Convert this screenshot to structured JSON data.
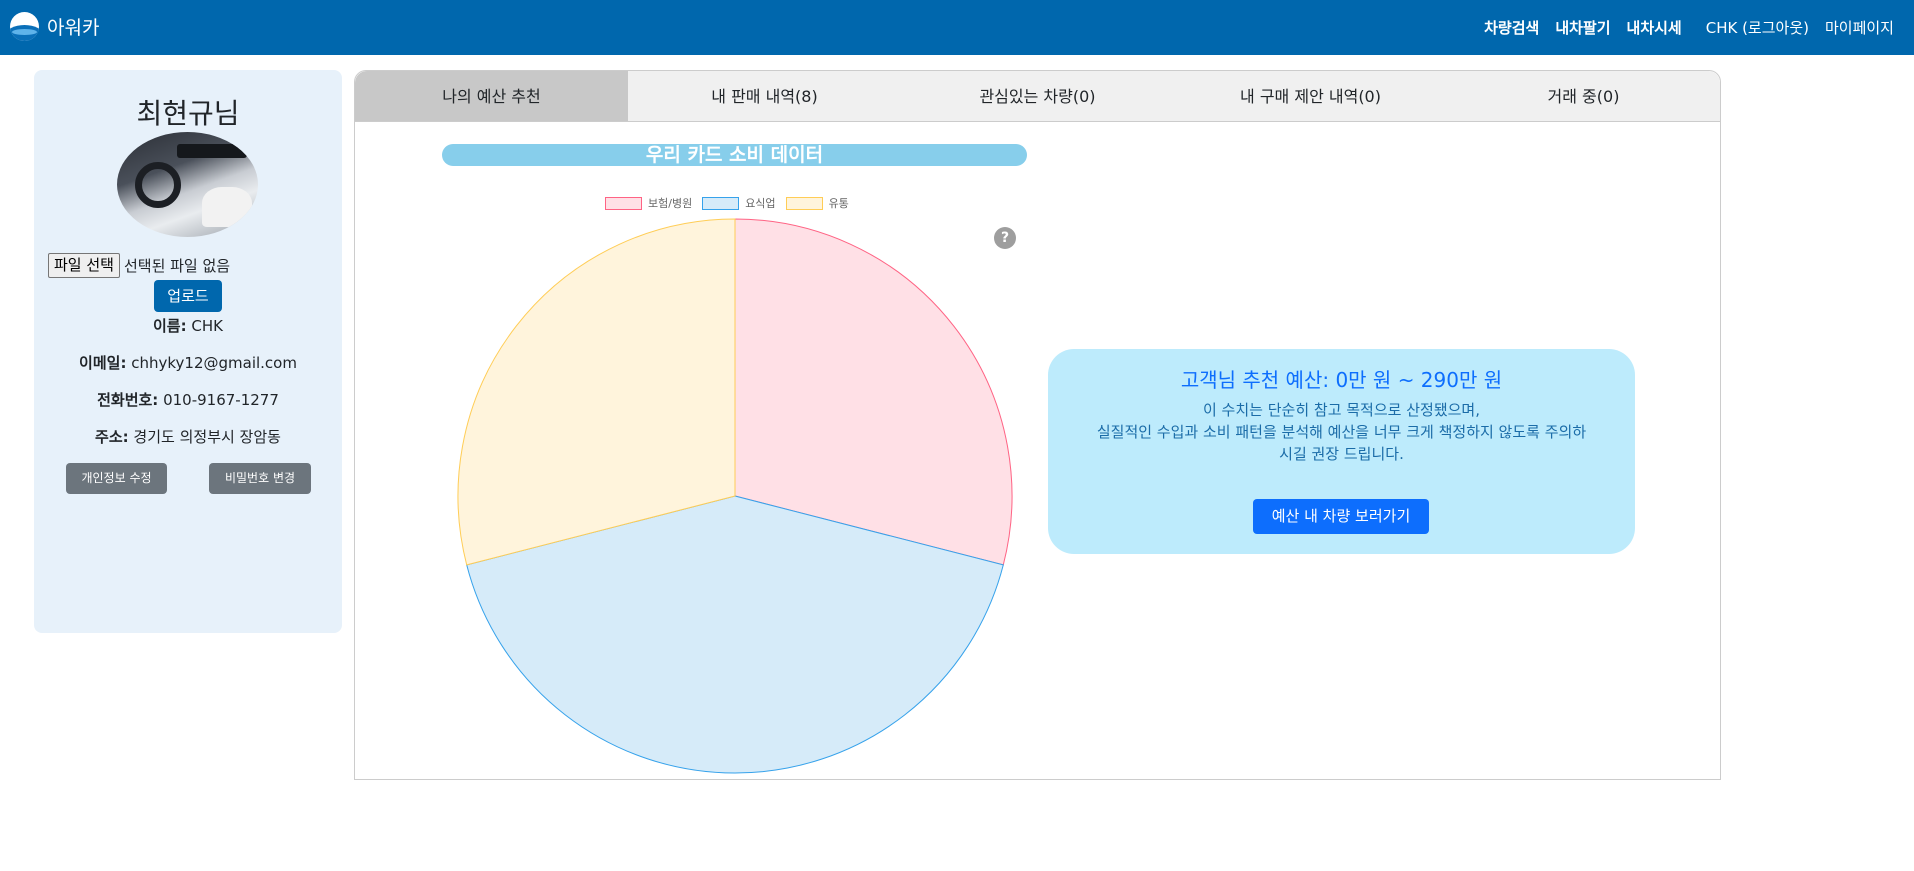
{
  "nav": {
    "brand": "아워카",
    "links": [
      "차량검색",
      "내차팔기",
      "내차시세"
    ],
    "user_logout": "CHK (로그아웃)",
    "mypage": "마이페이지"
  },
  "profile": {
    "name": "최현규님",
    "file_button": "파일 선택",
    "file_status": "선택된 파일 없음",
    "upload_button": "업로드",
    "name_label": "이름:",
    "name_value": "CHK",
    "email_label": "이메일:",
    "email_value": "chhyky12@gmail.com",
    "phone_label": "전화번호:",
    "phone_value": "010-9167-1277",
    "address_label": "주소:",
    "address_value": "경기도 의정부시 장암동",
    "edit_button": "개인정보 수정",
    "password_button": "비밀번호 변경"
  },
  "tabs": [
    {
      "label": "나의 예산 추천",
      "active": true
    },
    {
      "label": "내 판매 내역(8)",
      "active": false
    },
    {
      "label": "관심있는 차량(0)",
      "active": false
    },
    {
      "label": "내 구매 제안 내역(0)",
      "active": false
    },
    {
      "label": "거래 중(0)",
      "active": false
    }
  ],
  "help_icon": "?",
  "chart_data": {
    "type": "pie",
    "title": "우리 카드 소비 데이터",
    "legend_position": "top",
    "categories": [
      "보험/병원",
      "요식업",
      "유통"
    ],
    "values": [
      29,
      42,
      29
    ],
    "colors": {
      "fill": [
        "#ffe0e6",
        "#d6ebf9",
        "#fff4dc"
      ],
      "stroke": [
        "#ff6384",
        "#36a2eb",
        "#ffcd56"
      ]
    }
  },
  "budget": {
    "title": "고객님 추천 예산: 0만 원 ~ 290만 원",
    "desc_lines": [
      "이 수치는 단순히 참고 목적으로 산정됐으며,",
      "실질적인 수입과 소비 패턴을 분석해 예산을 너무 크게 책정하지 않도록 주의하",
      "시길 권장 드립니다."
    ],
    "button": "예산 내 차량 보러가기"
  }
}
